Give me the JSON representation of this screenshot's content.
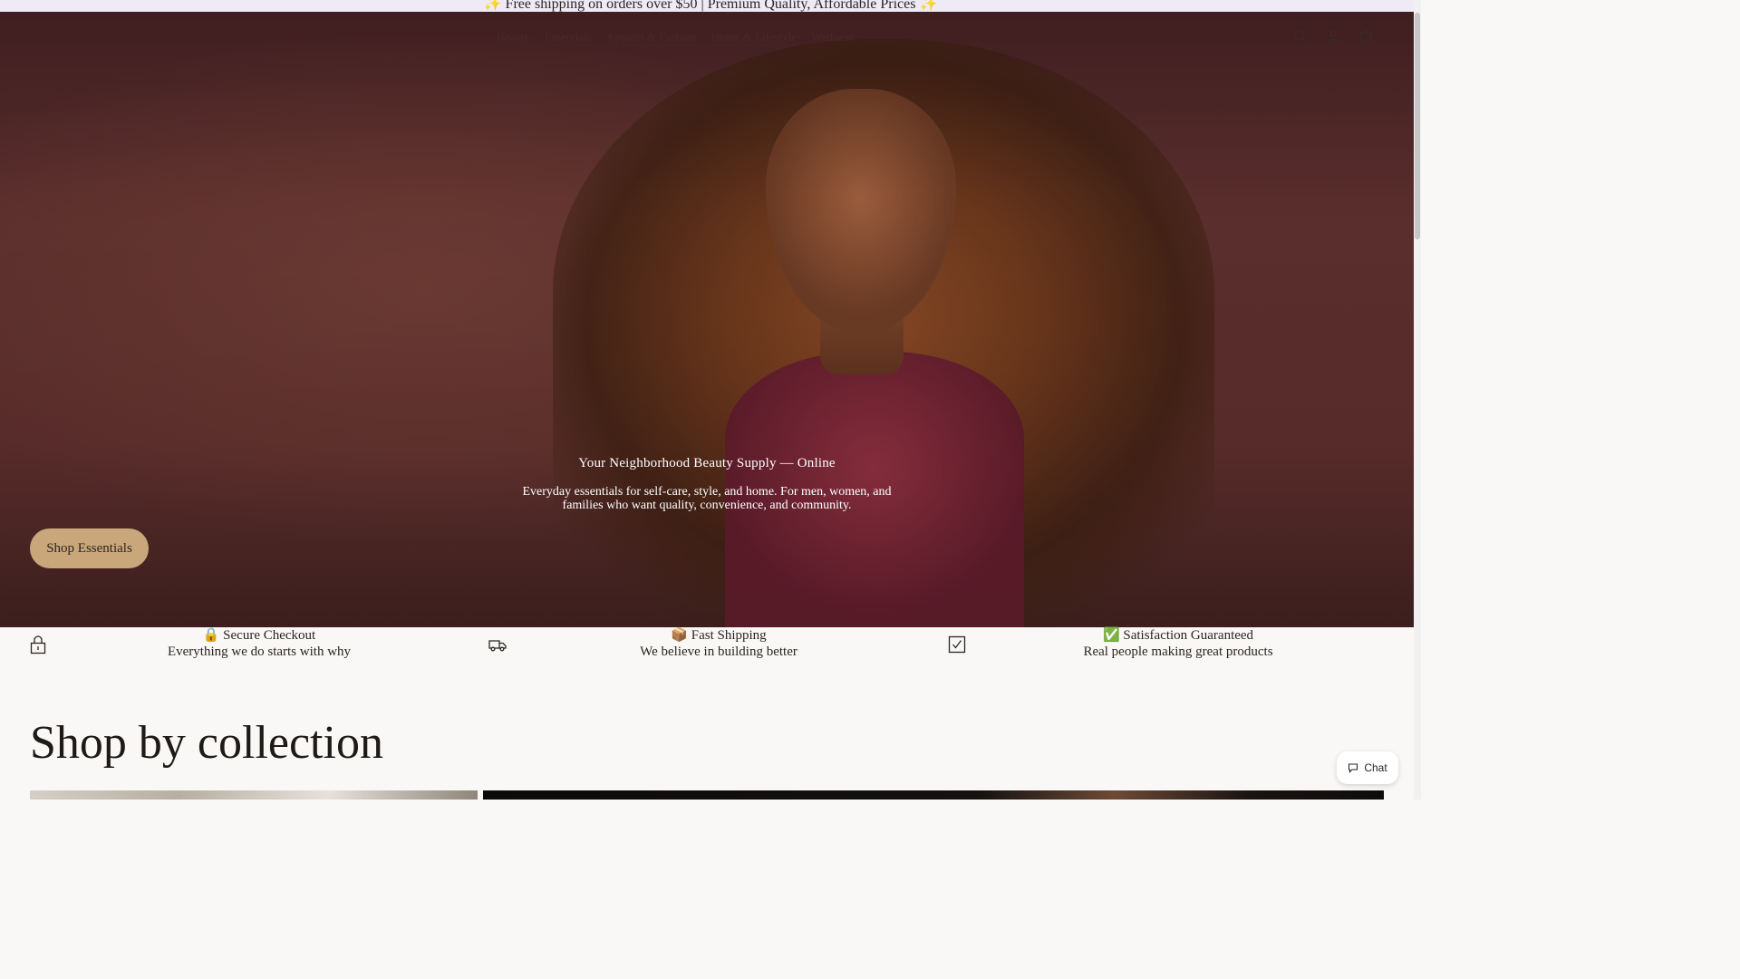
{
  "announcement": {
    "text": "✨ Free shipping on orders over $50 | Premium Quality, Affordable Prices ✨"
  },
  "nav": {
    "items": [
      {
        "label": "Beauty"
      },
      {
        "label": "Essentials"
      },
      {
        "label": "Apparel & Fashion"
      },
      {
        "label": "Home & Lifestyle"
      },
      {
        "label": "Wellness"
      }
    ],
    "icons": [
      "search-icon",
      "account-icon",
      "cart-icon"
    ]
  },
  "hero": {
    "title": "Your Neighborhood Beauty Supply — Online",
    "description": "Everyday essentials for self-care, style, and home. For men, women, and families who want quality, convenience, and community.",
    "button_label": "Shop Essentials"
  },
  "trust": [
    {
      "icon": "lock-icon",
      "title": "🔒 Secure Checkout",
      "subtitle": "Everything we do starts with why"
    },
    {
      "icon": "truck-icon",
      "title": "📦 Fast Shipping",
      "subtitle": "We believe in building better"
    },
    {
      "icon": "checkbox-icon",
      "title": "✅ Satisfaction Guaranteed",
      "subtitle": "Real people making great products"
    }
  ],
  "collections": {
    "title": "Shop by collection"
  },
  "chat": {
    "label": "Chat"
  },
  "colors": {
    "accent": "#c9a77b",
    "announcement_bg": "#eeebf7",
    "page_bg": "#faf8f6"
  }
}
